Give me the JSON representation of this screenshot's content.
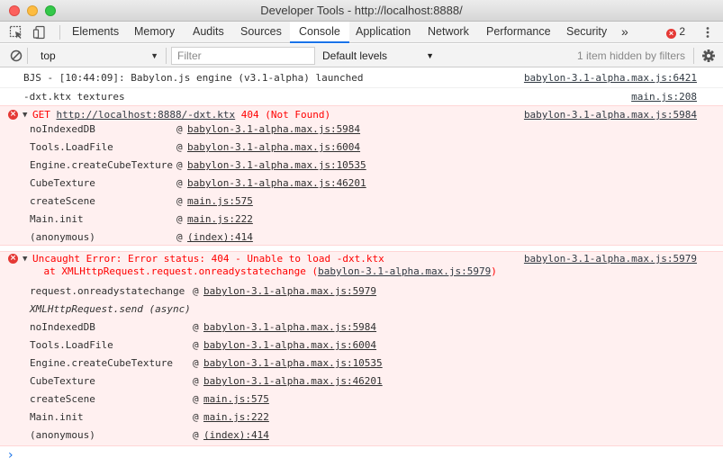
{
  "window": {
    "title": "Developer Tools - http://localhost:8888/"
  },
  "tabs": [
    "Elements",
    "Memory",
    "Audits",
    "Sources",
    "Console",
    "Application",
    "Network",
    "Performance",
    "Security"
  ],
  "active_tab": "Console",
  "more_tabs": "»",
  "error_count": "2",
  "toolbar": {
    "context": "top",
    "filter_placeholder": "Filter",
    "levels": "Default levels",
    "hidden_message": "1 item hidden by filters"
  },
  "messages": {
    "log1": {
      "text": "BJS - [10:44:09]: Babylon.js engine (v3.1-alpha) launched",
      "source": "babylon-3.1-alpha.max.js:6421"
    },
    "log2": {
      "text": "-dxt.ktx textures",
      "source": "main.js:208"
    },
    "error1": {
      "prefix": "GET ",
      "url": "http://localhost:8888/-dxt.ktx",
      "status": " 404 (Not Found)",
      "source": "babylon-3.1-alpha.max.js:5984",
      "frames": [
        {
          "fn": "noIndexedDB",
          "loc": "babylon-3.1-alpha.max.js:5984"
        },
        {
          "fn": "Tools.LoadFile",
          "loc": "babylon-3.1-alpha.max.js:6004"
        },
        {
          "fn": "Engine.createCubeTexture",
          "loc": "babylon-3.1-alpha.max.js:10535"
        },
        {
          "fn": "CubeTexture",
          "loc": "babylon-3.1-alpha.max.js:46201"
        },
        {
          "fn": "createScene",
          "loc": "main.js:575"
        },
        {
          "fn": "Main.init",
          "loc": "main.js:222"
        },
        {
          "fn": "(anonymous)",
          "loc": "(index):414"
        }
      ]
    },
    "error2": {
      "message": "Uncaught Error: Error status: 404 - Unable to load -dxt.ktx",
      "at_prefix": "    at XMLHttpRequest.request.onreadystatechange (",
      "at_loc": "babylon-3.1-alpha.max.js:5979",
      "at_suffix": ")",
      "source": "babylon-3.1-alpha.max.js:5979",
      "first_frame": {
        "fn": "request.onreadystatechange",
        "loc": "babylon-3.1-alpha.max.js:5979"
      },
      "async_label": "XMLHttpRequest.send (async)",
      "frames": [
        {
          "fn": "noIndexedDB",
          "loc": "babylon-3.1-alpha.max.js:5984"
        },
        {
          "fn": "Tools.LoadFile",
          "loc": "babylon-3.1-alpha.max.js:6004"
        },
        {
          "fn": "Engine.createCubeTexture",
          "loc": "babylon-3.1-alpha.max.js:10535"
        },
        {
          "fn": "CubeTexture",
          "loc": "babylon-3.1-alpha.max.js:46201"
        },
        {
          "fn": "createScene",
          "loc": "main.js:575"
        },
        {
          "fn": "Main.init",
          "loc": "main.js:222"
        },
        {
          "fn": "(anonymous)",
          "loc": "(index):414"
        }
      ]
    }
  },
  "at_symbol": "@",
  "expand_glyph": "▼",
  "prompt_glyph": "›",
  "colors": {
    "error_text": "#ff0000",
    "error_bg": "#fff0f0",
    "link": "#1a1aa6",
    "accent": "#1a73e8"
  }
}
